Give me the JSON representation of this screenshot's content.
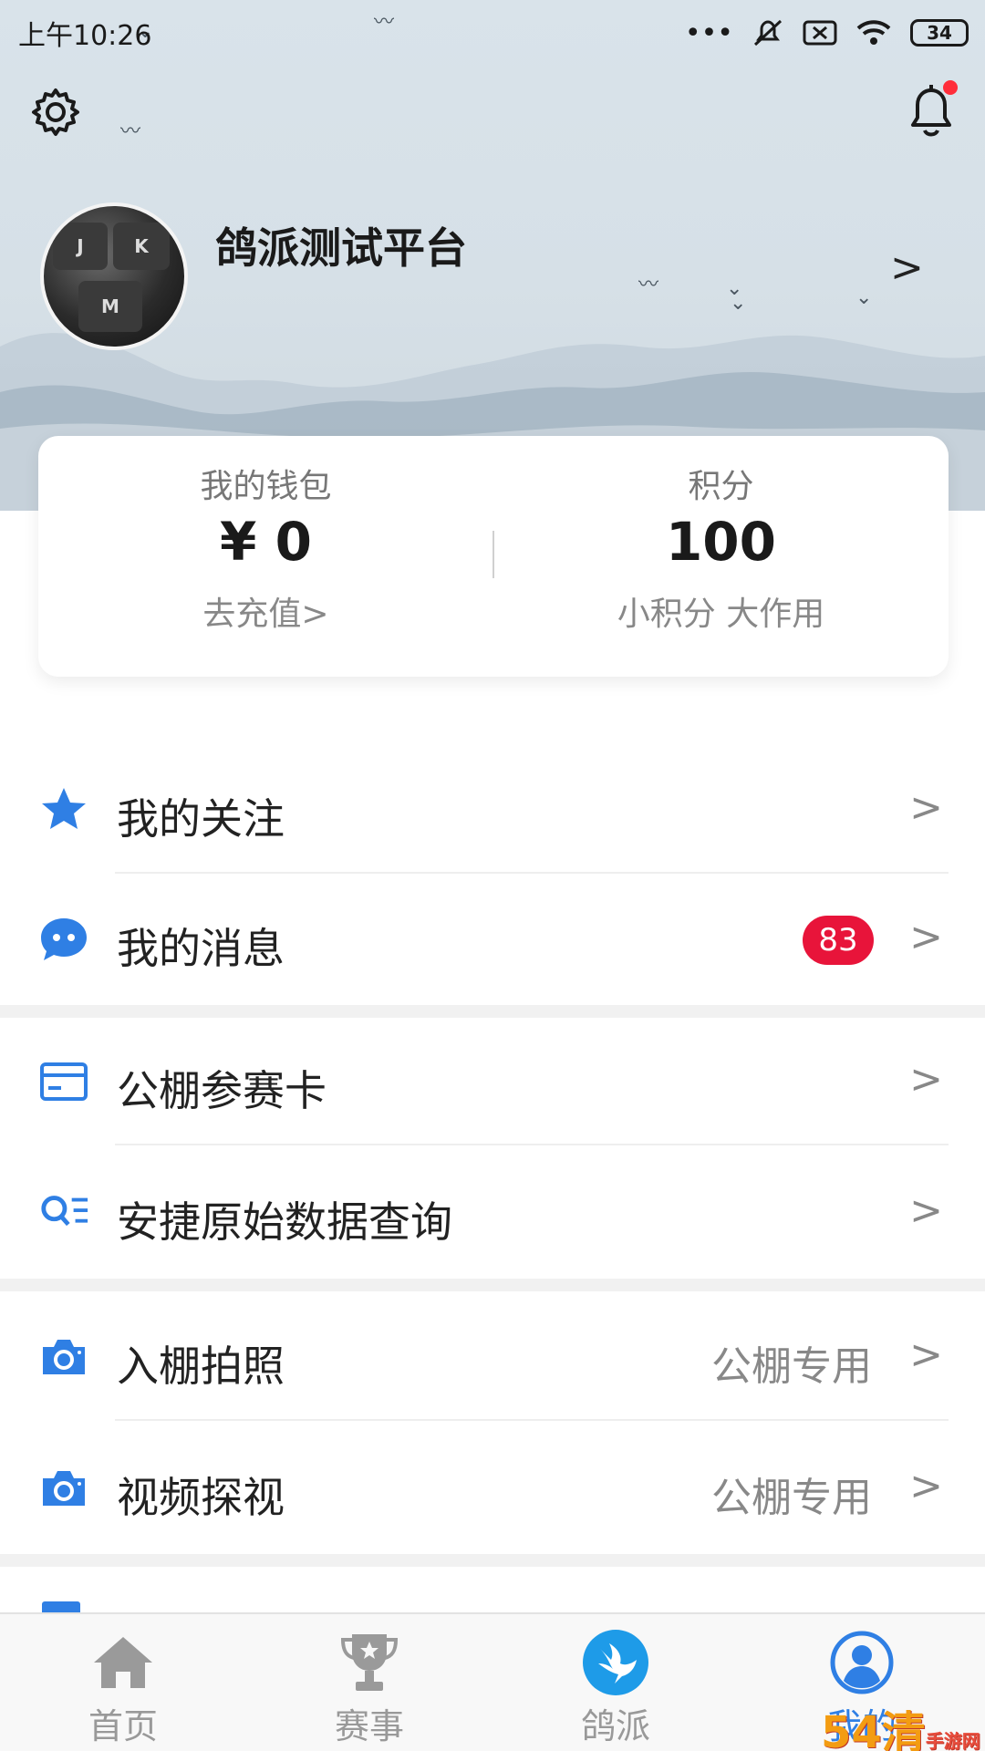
{
  "status_bar": {
    "time": "上午10:26",
    "battery": "34"
  },
  "profile": {
    "name": "鸽派测试平台",
    "arrow": ">"
  },
  "wallet_card": {
    "wallet_label": "我的钱包",
    "wallet_value": "¥ 0",
    "wallet_action": "去充值>",
    "points_label": "积分",
    "points_value": "100",
    "points_slogan": "小积分 大作用"
  },
  "menu": {
    "items": [
      {
        "label": "我的关注",
        "icon": "star-icon"
      },
      {
        "label": "我的消息",
        "icon": "chat-bubble-icon",
        "badge": "83"
      },
      {
        "label": "公棚参赛卡",
        "icon": "card-icon"
      },
      {
        "label": "安捷原始数据查询",
        "icon": "search-list-icon"
      },
      {
        "label": "入棚拍照",
        "icon": "camera-icon",
        "tag": "公棚专用"
      },
      {
        "label": "视频探视",
        "icon": "camera-icon",
        "tag": "公棚专用"
      }
    ],
    "arrow": ">"
  },
  "tab_bar": {
    "tabs": [
      {
        "label": "首页",
        "icon": "home-icon"
      },
      {
        "label": "赛事",
        "icon": "trophy-icon"
      },
      {
        "label": "鸽派",
        "icon": "pigeon-icon"
      },
      {
        "label": "我的",
        "icon": "user-icon",
        "active": true
      }
    ]
  },
  "watermark": {
    "text": "54清",
    "sub": "手游网"
  },
  "colors": {
    "accent": "#2f7fe4",
    "badge": "#e8143a",
    "notification_dot": "#ff2d3a"
  }
}
